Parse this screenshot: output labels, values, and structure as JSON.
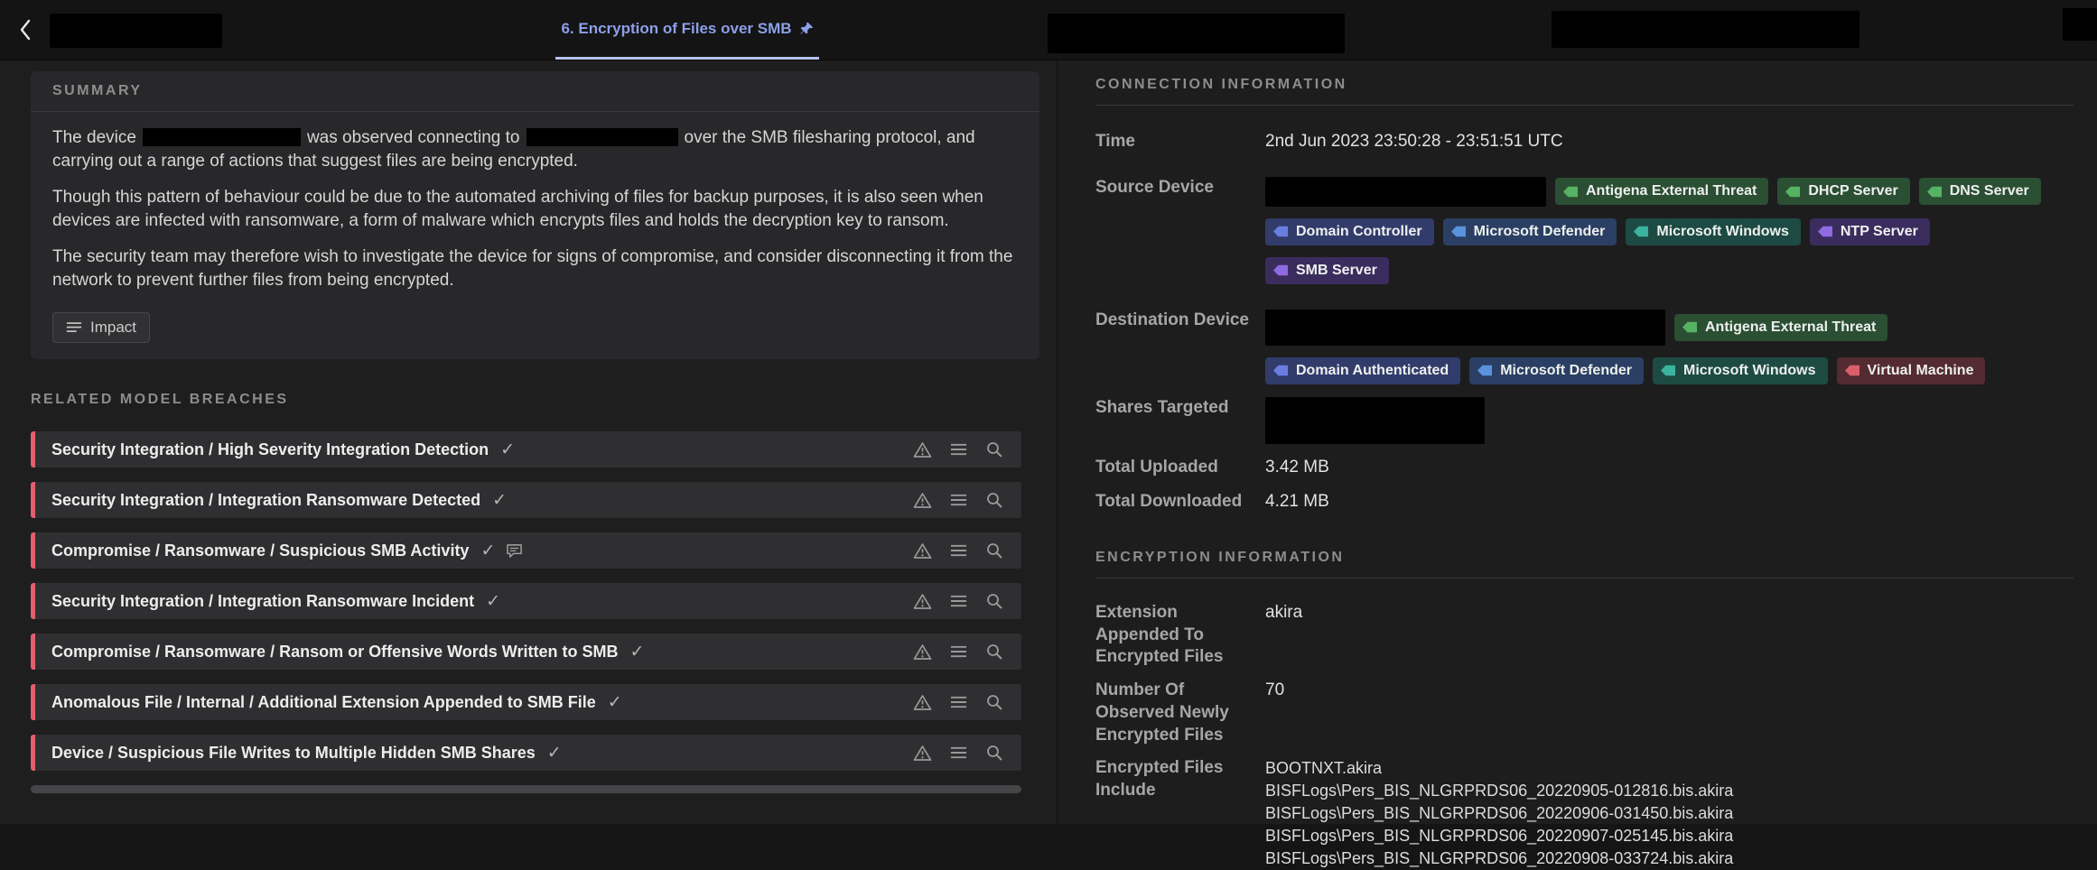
{
  "topbar": {
    "tab_label": "6. Encryption of Files over SMB"
  },
  "summary": {
    "title": "SUMMARY",
    "p1_before": "The device",
    "p1_mid": "was observed connecting to",
    "p1_after": "over the SMB filesharing protocol, and carrying out a range of actions that suggest files are being encrypted.",
    "p2": "Though this pattern of behaviour could be due to the automated archiving of files for backup purposes, it is also seen when devices are infected with ransomware, a form of malware which encrypts files and holds the decryption key to ransom.",
    "p3": "The security team may therefore wish to investigate the device for signs of compromise, and consider disconnecting it from the network to prevent further files from being encrypted.",
    "impact_label": "Impact"
  },
  "breaches": {
    "title": "RELATED MODEL BREACHES",
    "items": [
      {
        "label": "Security Integration / High Severity Integration Detection"
      },
      {
        "label": "Security Integration / Integration Ransomware Detected"
      },
      {
        "label": "Compromise / Ransomware / Suspicious SMB Activity"
      },
      {
        "label": "Security Integration / Integration Ransomware Incident"
      },
      {
        "label": "Compromise / Ransomware / Ransom or Offensive Words Written to SMB"
      },
      {
        "label": "Anomalous File / Internal / Additional Extension Appended to SMB File"
      },
      {
        "label": "Device / Suspicious File Writes to Multiple Hidden SMB Shares"
      }
    ]
  },
  "connection": {
    "title": "CONNECTION INFORMATION",
    "time_label": "Time",
    "time_value": "2nd Jun 2023 23:50:28 - 23:51:51 UTC",
    "source_label": "Source Device",
    "source_tags": [
      {
        "label": "Antigena External Threat",
        "color": "green"
      },
      {
        "label": "DHCP Server",
        "color": "green"
      },
      {
        "label": "DNS Server",
        "color": "green"
      },
      {
        "label": "Domain Controller",
        "color": "indigo"
      },
      {
        "label": "Microsoft Defender",
        "color": "blue"
      },
      {
        "label": "Microsoft Windows",
        "color": "teal"
      },
      {
        "label": "NTP Server",
        "color": "purple"
      },
      {
        "label": "SMB Server",
        "color": "purple"
      }
    ],
    "destination_label": "Destination Device",
    "destination_tags": [
      {
        "label": "Antigena External Threat",
        "color": "green"
      },
      {
        "label": "Domain Authenticated",
        "color": "indigo"
      },
      {
        "label": "Microsoft Defender",
        "color": "blue"
      },
      {
        "label": "Microsoft Windows",
        "color": "teal"
      },
      {
        "label": "Virtual Machine",
        "color": "red"
      }
    ],
    "shares_label": "Shares Targeted",
    "uploaded_label": "Total Uploaded",
    "uploaded_value": "3.42 MB",
    "downloaded_label": "Total Downloaded",
    "downloaded_value": "4.21 MB"
  },
  "encryption": {
    "title": "ENCRYPTION INFORMATION",
    "extension_label": "Extension Appended To Encrypted Files",
    "extension_value": "akira",
    "count_label": "Number Of Observed Newly Encrypted Files",
    "count_value": "70",
    "files_label": "Encrypted Files Include",
    "files": [
      "BOOTNXT.akira",
      "BISFLogs\\Pers_BIS_NLGRPRDS06_20220905-012816.bis.akira",
      "BISFLogs\\Pers_BIS_NLGRPRDS06_20220906-031450.bis.akira",
      "BISFLogs\\Pers_BIS_NLGRPRDS06_20220907-025145.bis.akira",
      "BISFLogs\\Pers_BIS_NLGRPRDS06_20220908-033724.bis.akira"
    ]
  },
  "palette": {
    "accent_tab": "#8c9fe8",
    "tab_underline": "#b6c0f0",
    "breach_border": "#e0606f",
    "tag_green": "#56b363",
    "tag_blue": "#5b92de",
    "tag_indigo": "#6a7ee2",
    "tag_teal": "#3cb3a0",
    "tag_purple": "#8f6ae0",
    "tag_red": "#da5f6b",
    "card_bg": "#28282a",
    "page_bg": "#1e1e1f"
  }
}
